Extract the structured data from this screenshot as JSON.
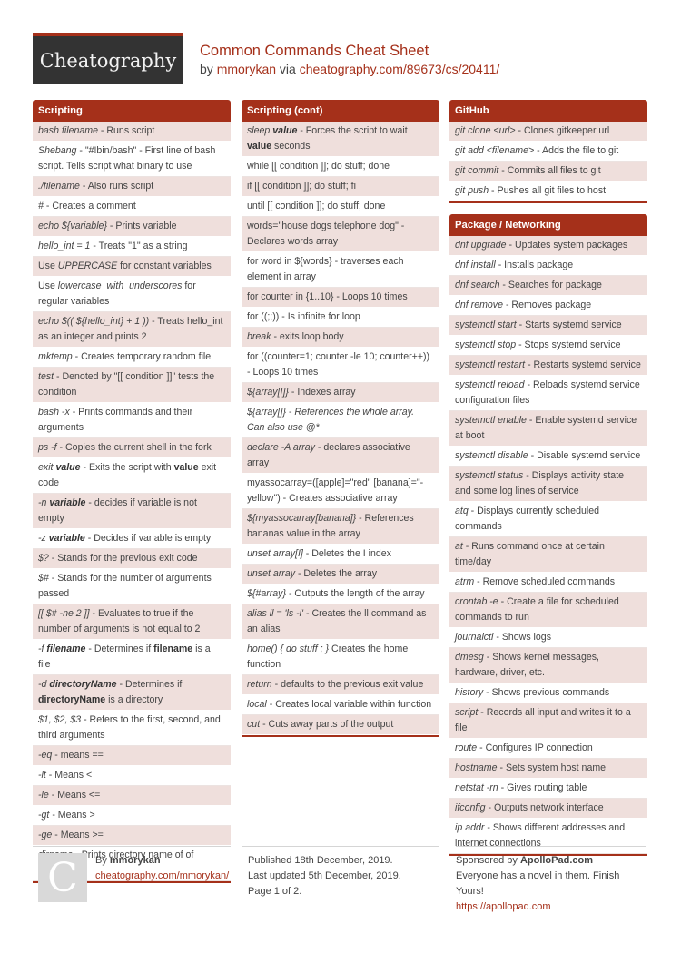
{
  "header": {
    "logo": "Cheatography",
    "title": "Common Commands Cheat Sheet",
    "by_prefix": "by ",
    "author": "mmorykan",
    "via": " via ",
    "url": "cheatography.com/89673/cs/20411/"
  },
  "colors": {
    "accent": "#a5301a",
    "row_shade": "#efdfdc",
    "logo_bg": "#333333"
  },
  "sections": {
    "scripting": {
      "title": "Scripting",
      "rows": [
        "<i>bash filename</i> - Runs script",
        "<i>Shebang</i> - \"#!bin/bash\" - First line of bash script. Tells script what binary to use",
        "<i>./filename</i> - Also runs script",
        "<i>#</i> - Creates a comment",
        "<i>echo ${variable}</i> - Prints variable",
        "<i>hello_int = 1</i> - Treats \"1\" as a string",
        "Use <i>UPPERCASE</i> for constant variables",
        "Use <i>lowercase_with_underscores</i> for regular variables",
        "<i>echo $(( ${hello_int} + 1 ))</i> - Treats hello_int as an integer and prints 2",
        "<i>mktemp</i> - Creates temporary random file",
        "<i>test</i> - Denoted by \"[[ condition ]]\" tests the condition",
        "<i>bash -x</i> - Prints commands and their arguments",
        "<i>ps -f</i> - Copies the current shell in the fork",
        "<i>exit <b>value</b></i> - Exits the script with <b>value</b> exit code",
        "<i>-n <b>variable</b></i> - decides if variable is not empty",
        "<i>-z <b>variable</b></i> - Decides if variable is empty",
        "<i>$?</i> - Stands for the previous exit code",
        "<i>$#</i> - Stands for the number of arguments passed",
        "<i>[[ $# -ne 2 ]]</i> - Evaluates to true if the number of arguments is not equal to 2",
        "<i>-f <b>filename</b></i> - Determines if <b>filename</b> is a file",
        "<i>-d <b>directoryName</b></i> - Determines if <b>directoryName</b> is a directory",
        "<i>$1, $2, $3</i> - Refers to the first, second, and third arguments",
        "<i>-eq</i> - means ==",
        "<i>-lt</i> - Means &lt;",
        "<i>-le</i> - Means &lt;=",
        "<i>-gt</i> - Means &gt;",
        "<i>-ge</i> - Means &gt;=",
        "<i>dirname</i> - Prints directory name of of argument"
      ]
    },
    "scripting_cont": {
      "title": "Scripting (cont)",
      "rows": [
        "<i>sleep <b>value</b></i> - Forces the script to wait <b>value</b> seconds",
        "while [[ condition ]]; do stuff; done",
        "if [[ condition ]]; do stuff; fi",
        "until [[ condition ]]; do stuff; done",
        "words=\"house dogs telephone dog\" - Declares words array",
        "for word in ${words} - traverses each element in array",
        "for counter in {1..10} - Loops 10 times",
        "for ((;;)) - Is infinite for loop",
        "<i>break</i> - exits loop body",
        "for ((counter=1; counter -le 10; counter++)) - Loops 10 times",
        "<i>${array[I]}</i> - Indexes array",
        "<i>${array[]}</i> - <i>References the whole array. Can also use @*</i>",
        "<i>declare -A array</i> - declares associative array",
        "myassocarray=([apple]=\"red\" [banana]=\"-yellow\") - Creates associative array",
        "<i>${myassocarray[banana]}</i> - References bananas value in the array",
        "<i>unset array[I]</i> - Deletes the I index",
        "<i>unset array</i> - Deletes the array",
        "<i>${#array}</i> - Outputs the length of the array",
        "<i>alias ll = 'ls -l'</i> - Creates the ll command as an alias",
        "<i>home() { do stuff ; }</i> Creates the home function",
        "<i>return</i> - defaults to the previous exit value",
        "<i>local</i> - Creates local variable within function",
        "<i>cut</i> - Cuts away parts of the output"
      ]
    },
    "github": {
      "title": "GitHub",
      "rows": [
        "<i>git clone &lt;url&gt;</i> - Clones gitkeeper url",
        "<i>git add &lt;filename&gt;</i> - Adds the file to git",
        "<i>git commit</i> - Commits all files to git",
        "<i>git push</i> - Pushes all git files to host"
      ]
    },
    "package_networking": {
      "title": "Package / Networking",
      "rows": [
        "<i>dnf upgrade</i> - Updates system packages",
        "<i>dnf install</i> - Installs package",
        "<i>dnf search</i> - Searches for package",
        "<i>dnf remove</i> - Removes package",
        "<i>systemctl start</i> - Starts systemd service",
        "<i>systemctl stop</i> - Stops systemd service",
        "<i>systemctl restart</i> - Restarts systemd service",
        "<i>systemctl reload</i> - Reloads systemd service configuration files",
        "<i>systemctl enable</i> - Enable systemd service at boot",
        "<i>systemctl disable</i> - Disable systemd service",
        "<i>systemctl status</i> - Displays activity state and some log lines of service",
        "<i>atq</i> - Displays currently scheduled commands",
        "<i>at</i> - Runs command once at certain time/day",
        "<i>atrm</i> - Remove scheduled commands",
        "<i>crontab -e</i> - Create a file for scheduled commands to run",
        "<i>journalctl</i> - Shows logs",
        "<i>dmesg</i> - Shows kernel messages, hardware, driver, etc.",
        "<i>history</i> - Shows previous commands",
        "<i>script</i> - Records all input and writes it to a file",
        "<i>route</i> - Configures IP connection",
        "<i>hostname</i> - Sets system host name",
        "<i>netstat -rn</i> - Gives routing table",
        "<i>ifconfig</i> - Outputs network interface",
        "<i>ip addr</i> - Shows different addresses and internet connections"
      ]
    }
  },
  "footer": {
    "avatar_letter": "C",
    "by_label": "By ",
    "author": "mmorykan",
    "author_url": "cheatography.com/mmorykan/",
    "published": "Published 18th December, 2019.",
    "updated": "Last updated 5th December, 2019.",
    "page": "Page 1 of 2.",
    "sponsored_label": "Sponsored by ",
    "sponsor": "ApolloPad.com",
    "sponsor_text": "Everyone has a novel in them. Finish Yours!",
    "sponsor_url": "https://apollopad.com"
  }
}
